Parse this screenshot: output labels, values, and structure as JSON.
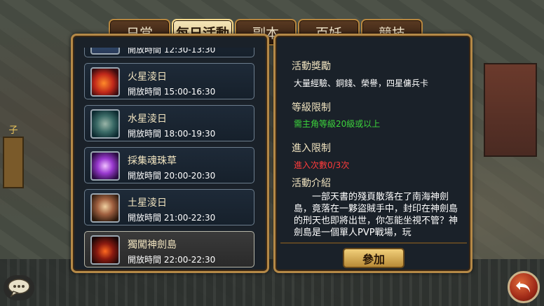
{
  "tabs": [
    {
      "label": "日常",
      "active": false
    },
    {
      "label": "每日活動",
      "active": true
    },
    {
      "label": "副本",
      "active": false
    },
    {
      "label": "百妖",
      "active": false
    },
    {
      "label": "競技",
      "active": false
    }
  ],
  "activities": [
    {
      "name": "",
      "time": "開放時間 12:30-13:30",
      "icon": "partial-icon"
    },
    {
      "name": "火星淩日",
      "time": "開放時間 15:00-16:30",
      "icon": "phoenix-icon"
    },
    {
      "name": "水星淩日",
      "time": "開放時間 18:00-19:30",
      "icon": "beast-icon"
    },
    {
      "name": "採集魂珠草",
      "time": "開放時間 20:00-20:30",
      "icon": "flower-icon"
    },
    {
      "name": "土星淩日",
      "time": "開放時間 21:00-22:30",
      "icon": "monster-icon"
    },
    {
      "name": "獨闖神劍島",
      "time": "開放時間 22:00-22:30",
      "icon": "sword-icon",
      "selected": true
    }
  ],
  "detail": {
    "reward_title": "活動獎勵",
    "reward_text": "大量經驗、銅錢、榮譽，四星傭兵卡",
    "level_title": "等級限制",
    "level_text": "需主角等級20級或以上",
    "entry_title": "進入限制",
    "entry_text": "進入次數0/3次",
    "intro_title": "活動介紹",
    "intro_text": "一部天書的殘頁散落在了南海神劍島，竟落在一夥盜賊手中，封印在神劍島的刑天也即將出世，你怎能坐視不管？神劍島是一個單人PVP戰場，玩",
    "join_label": "參加"
  },
  "colors": {
    "level_text": "#3cd43c",
    "entry_text": "#ff3b3b",
    "accent_gold": "#b58947"
  },
  "scene": {
    "left_sign": "子"
  }
}
